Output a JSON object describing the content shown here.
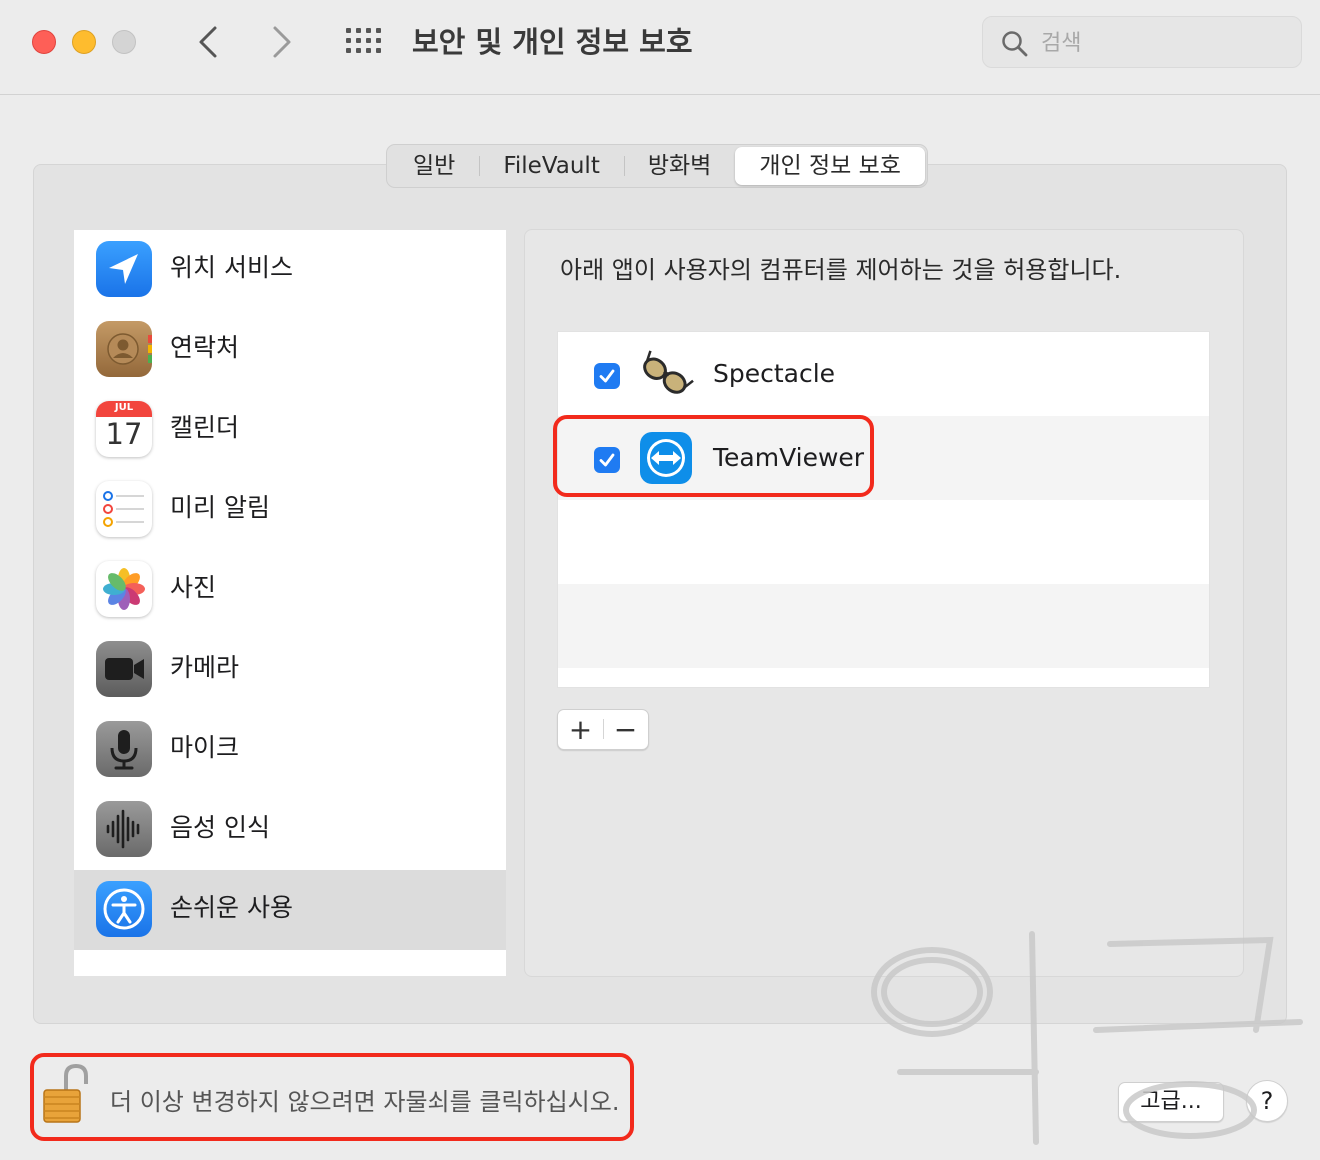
{
  "window": {
    "title": "보안 및 개인 정보 보호"
  },
  "search": {
    "placeholder": "검색",
    "value": ""
  },
  "tabs": [
    {
      "label": "일반",
      "active": false
    },
    {
      "label": "FileVault",
      "active": false
    },
    {
      "label": "방화벽",
      "active": false
    },
    {
      "label": "개인 정보 보호",
      "active": true
    }
  ],
  "sidebar": {
    "items": [
      {
        "label": "위치 서비스",
        "icon": "location-arrow-icon",
        "selected": false
      },
      {
        "label": "연락처",
        "icon": "contacts-icon",
        "selected": false
      },
      {
        "label": "캘린더",
        "icon": "calendar-icon",
        "selected": false,
        "calendar_month": "JUL",
        "calendar_day": "17"
      },
      {
        "label": "미리 알림",
        "icon": "reminders-icon",
        "selected": false
      },
      {
        "label": "사진",
        "icon": "photos-icon",
        "selected": false
      },
      {
        "label": "카메라",
        "icon": "camera-icon",
        "selected": false
      },
      {
        "label": "마이크",
        "icon": "microphone-icon",
        "selected": false
      },
      {
        "label": "음성 인식",
        "icon": "speech-recognition-icon",
        "selected": false
      },
      {
        "label": "손쉬운 사용",
        "icon": "accessibility-icon",
        "selected": true
      }
    ]
  },
  "detail": {
    "description": "아래 앱이 사용자의 컴퓨터를 제어하는 것을 허용합니다.",
    "apps": [
      {
        "name": "Spectacle",
        "checked": true,
        "icon": "spectacle-glasses-icon"
      },
      {
        "name": "TeamViewer",
        "checked": true,
        "icon": "teamviewer-icon",
        "highlighted": true
      }
    ],
    "add_label": "+",
    "remove_label": "−"
  },
  "footer": {
    "lock_text": "더 이상 변경하지 않으려면 자물쇠를 클릭하십시오.",
    "lock_state": "unlocked",
    "advanced_label": "고급...",
    "help_label": "?"
  },
  "colors": {
    "highlight": "#f22a1c",
    "checkbox": "#1f7bf2",
    "selected_row": "#dcdcdc"
  }
}
